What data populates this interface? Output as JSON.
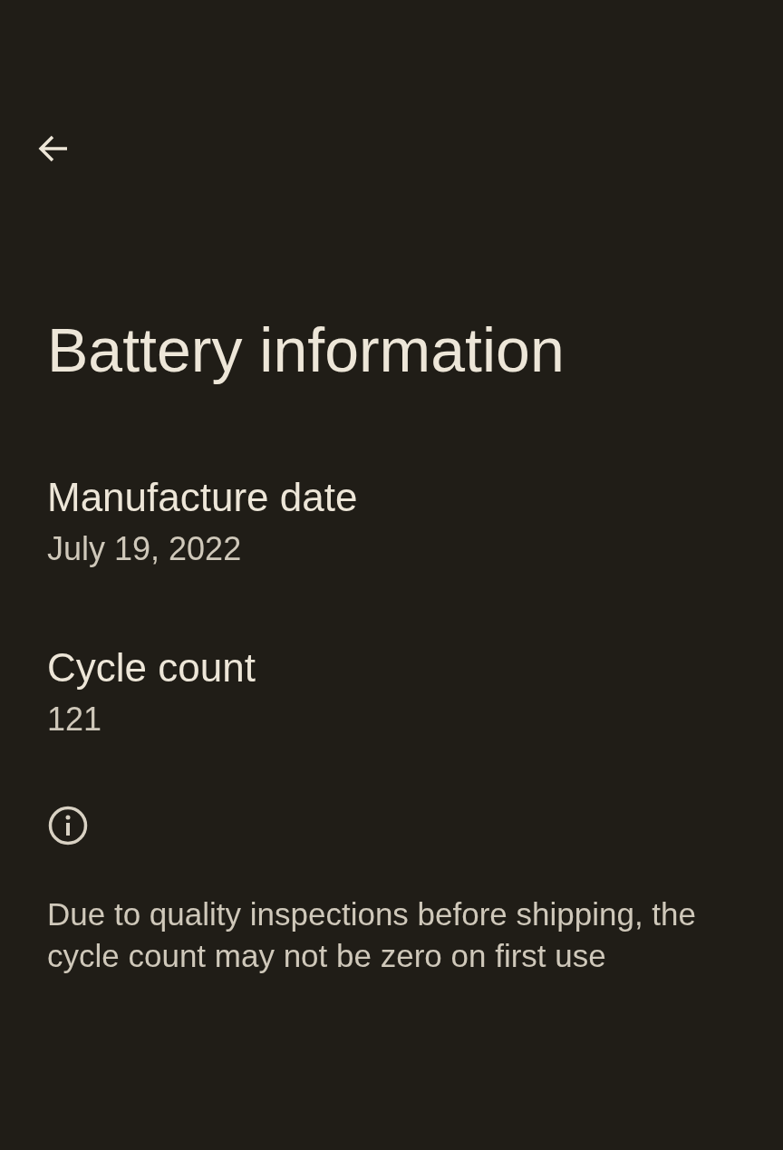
{
  "title": "Battery information",
  "items": [
    {
      "label": "Manufacture date",
      "value": "July 19, 2022"
    },
    {
      "label": "Cycle count",
      "value": "121"
    }
  ],
  "footnote": "Due to quality inspections before shipping, the cycle count may not be zero on first use"
}
